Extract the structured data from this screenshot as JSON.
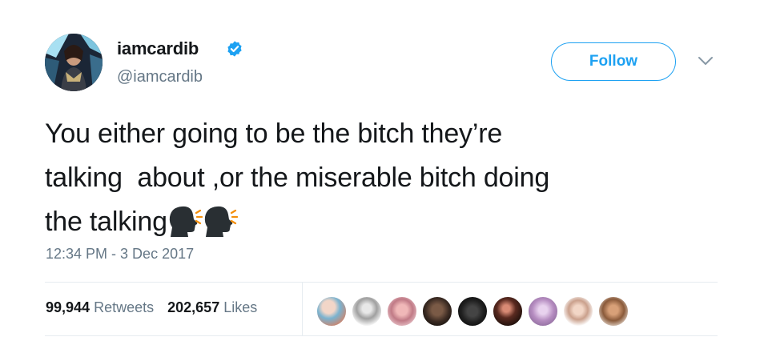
{
  "user": {
    "display_name": "iamcardib",
    "screen_name": "@iamcardib",
    "verified": true
  },
  "actions": {
    "follow_label": "Follow"
  },
  "tweet": {
    "text_line1": "You either going to be the bitch they’re",
    "text_line2": "talking  about ,or the miserable bitch doing",
    "text_line3": "the talking",
    "emojis": [
      "speaking-head-icon",
      "speaking-head-icon"
    ],
    "timestamp": "12:34 PM - 3 Dec 2017"
  },
  "stats": {
    "retweets_count": "99,944",
    "retweets_label": "Retweets",
    "likes_count": "202,657",
    "likes_label": "Likes"
  },
  "likers": [
    {
      "icon": "liker-avatar-1"
    },
    {
      "icon": "liker-avatar-2"
    },
    {
      "icon": "liker-avatar-3"
    },
    {
      "icon": "liker-avatar-4"
    },
    {
      "icon": "liker-avatar-5"
    },
    {
      "icon": "liker-avatar-6"
    },
    {
      "icon": "liker-avatar-7"
    },
    {
      "icon": "liker-avatar-8"
    },
    {
      "icon": "liker-avatar-9"
    }
  ],
  "colors": {
    "accent": "#1da1f2",
    "muted": "#657786",
    "text": "#14171a",
    "divider": "#e6ecf0"
  }
}
